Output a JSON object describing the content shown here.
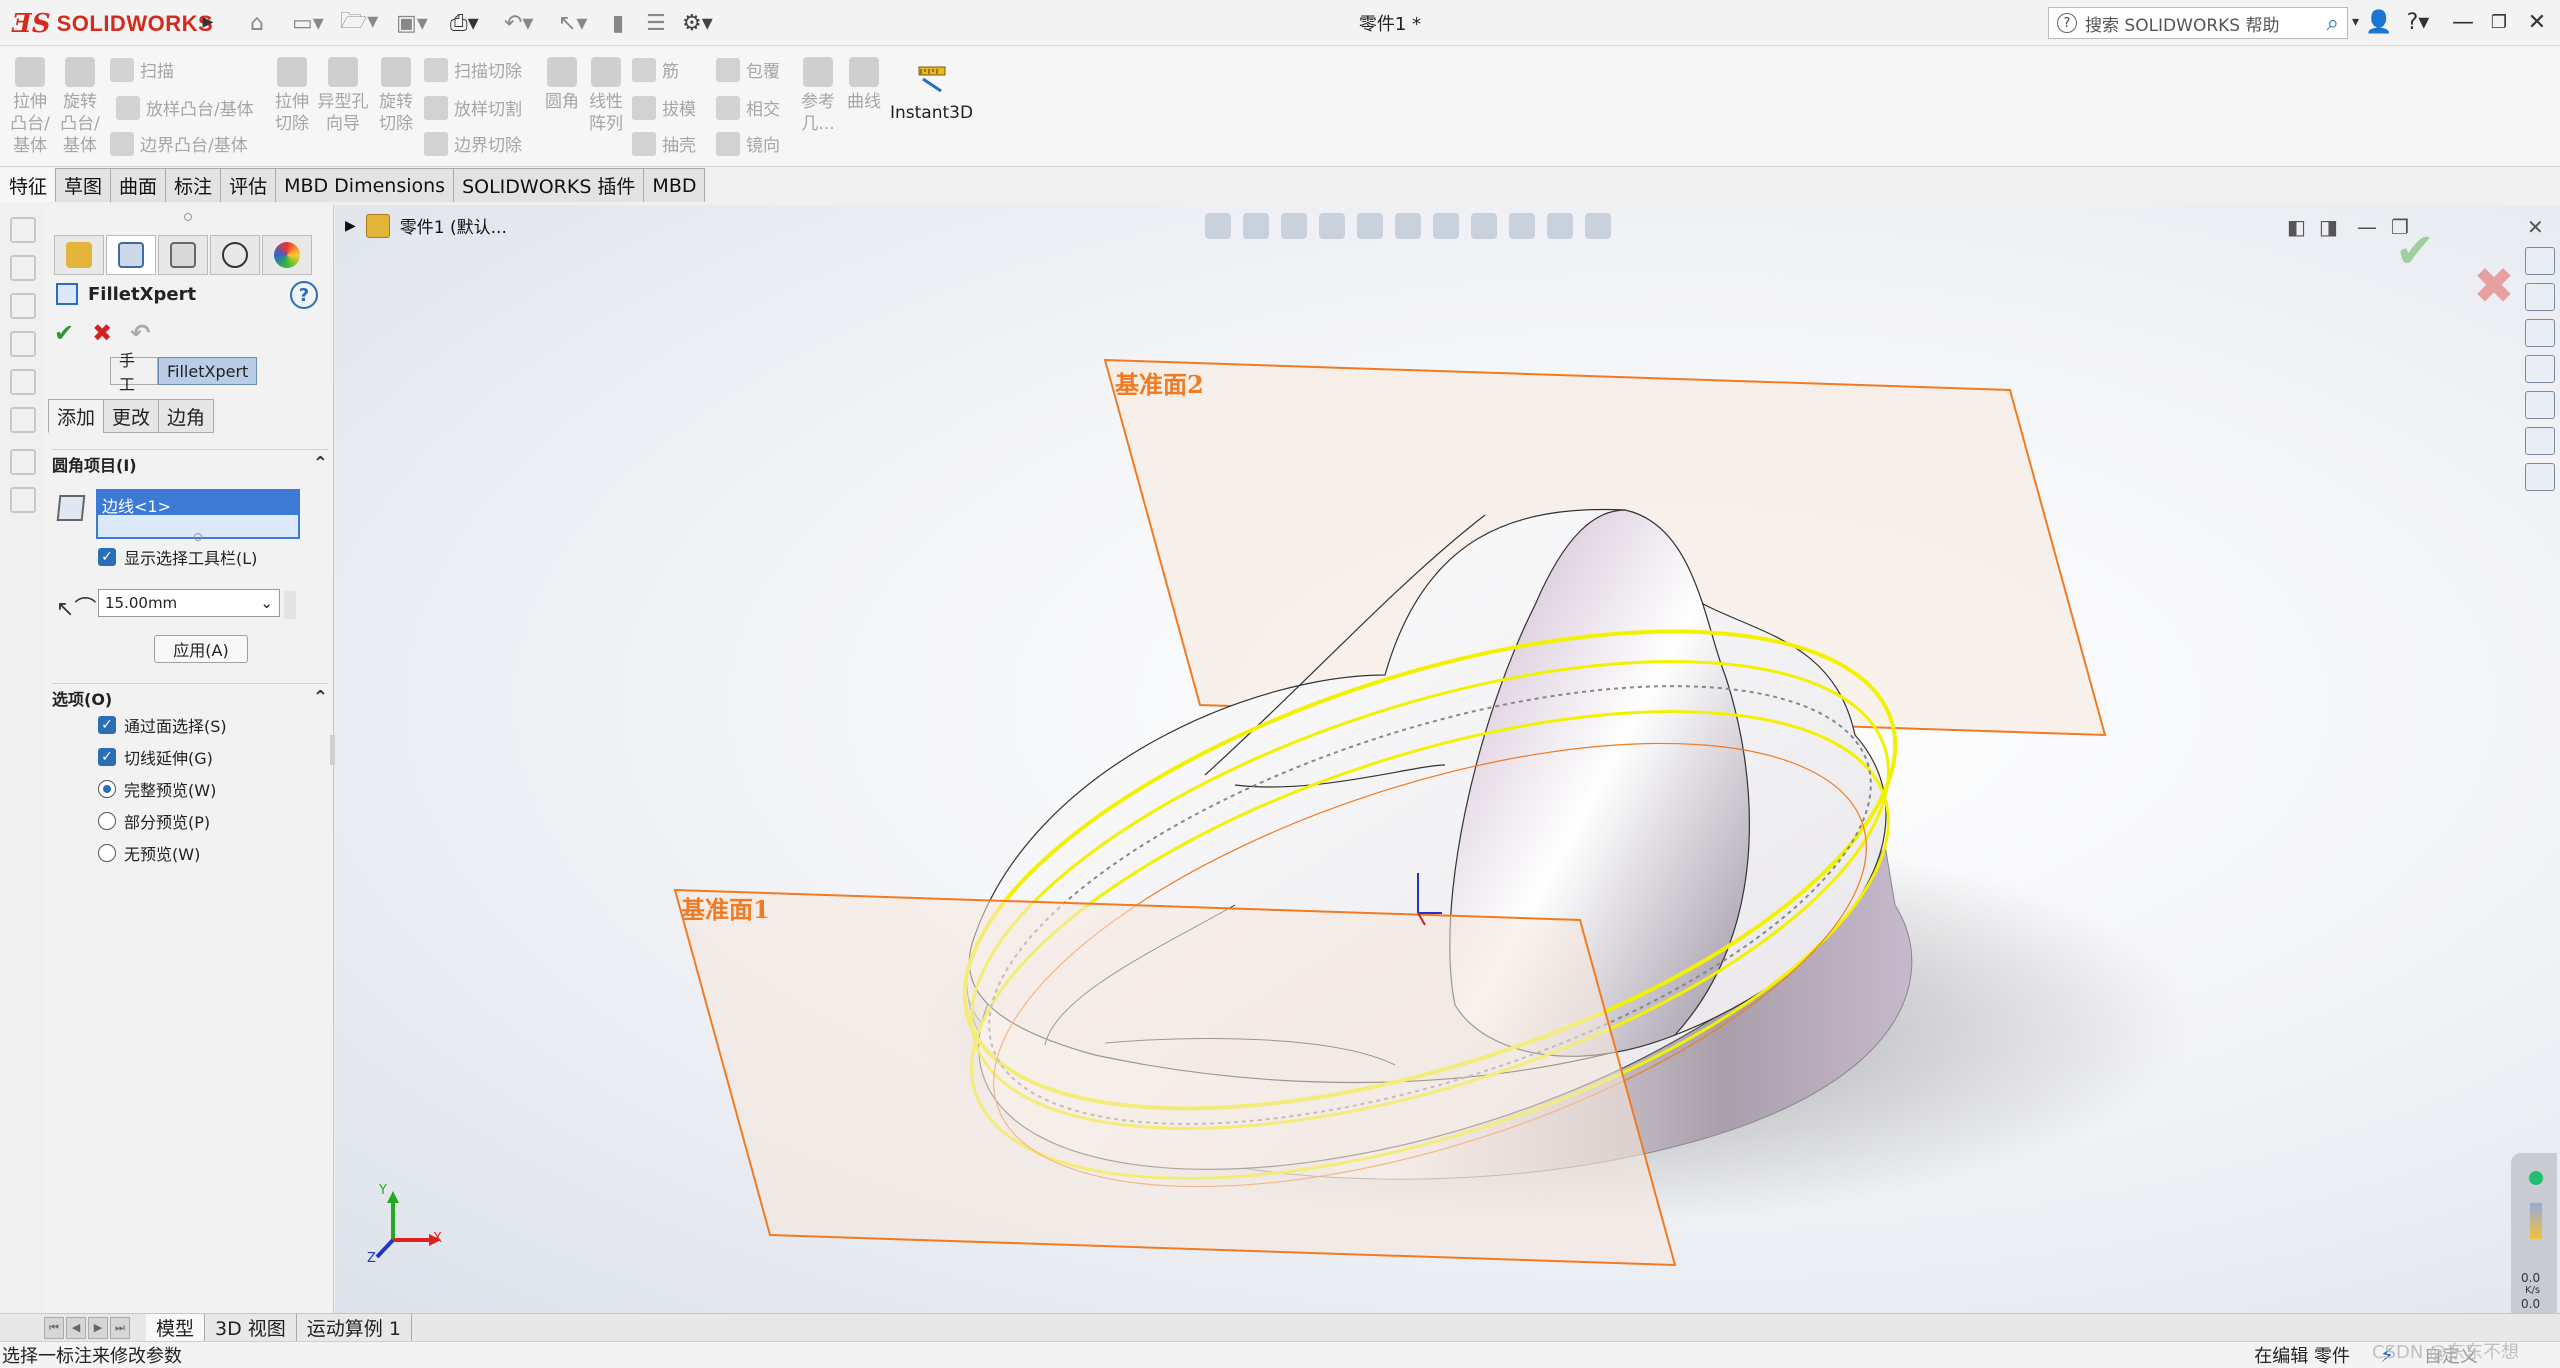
{
  "app": {
    "brand_ds": "3S",
    "brand_name": "SOLIDWORKS",
    "doc_title": "零件1 *",
    "search_placeholder": "搜索 SOLIDWORKS 帮助"
  },
  "ribbon": {
    "extrude_boss": "拉伸\n凸台/\n基体",
    "revolve_boss": "旋转\n凸台/\n基体",
    "sweep": "扫描",
    "loft_boss": "放样凸台/基体",
    "boundary_boss": "边界凸台/基体",
    "extrude_cut": "拉伸\n切除",
    "hole_wizard": "异型孔\n向导",
    "revolve_cut": "旋转\n切除",
    "sweep_cut": "扫描切除",
    "loft_cut": "放样切割",
    "boundary_cut": "边界切除",
    "fillet": "圆角",
    "linear_pattern": "线性\n阵列",
    "rib": "筋",
    "draft": "拔模",
    "shell": "抽壳",
    "wrap": "包覆",
    "intersect": "相交",
    "mirror": "镜向",
    "ref_geometry": "参考\n几...",
    "curves": "曲线",
    "instant3d": "Instant3D"
  },
  "tabs": [
    "特征",
    "草图",
    "曲面",
    "标注",
    "评估",
    "MBD Dimensions",
    "SOLIDWORKS 插件",
    "MBD"
  ],
  "property_manager": {
    "title": "FilletXpert",
    "help": "?",
    "mode_manual": "手工",
    "mode_filletxpert": "FilletXpert",
    "subtabs": [
      "添加",
      "更改",
      "边角"
    ],
    "items_header": "圆角项目(I)",
    "selected_item": "边线<1>",
    "show_toolbar": "显示选择工具栏(L)",
    "radius": "15.00mm",
    "apply": "应用(A)",
    "options_header": "选项(O)",
    "opt_select_through_faces": "通过面选择(S)",
    "opt_tangent_propagation": "切线延伸(G)",
    "opt_full_preview": "完整预览(W)",
    "opt_partial_preview": "部分预览(P)",
    "opt_no_preview": "无预览(W)"
  },
  "viewport": {
    "tree_root": "零件1 (默认...",
    "plane1": "基准面1",
    "plane2": "基准面2",
    "triad_x": "X",
    "triad_y": "Y",
    "triad_z": "Z",
    "rate1": "0.0",
    "rate2": "0.0",
    "rate_unit": "K/s"
  },
  "bottom_tabs": [
    "模型",
    "3D 视图",
    "运动算例 1"
  ],
  "status": {
    "message": "选择一标注来修改参数",
    "editing": "在编辑 零件",
    "custom": "自定义",
    "watermark": "CSDN @东东不想"
  },
  "colors": {
    "brand": "#d52b1e",
    "plane_edge": "#f07b22",
    "selection_yellow": "#f2f200",
    "accent_blue": "#2a6db8"
  }
}
